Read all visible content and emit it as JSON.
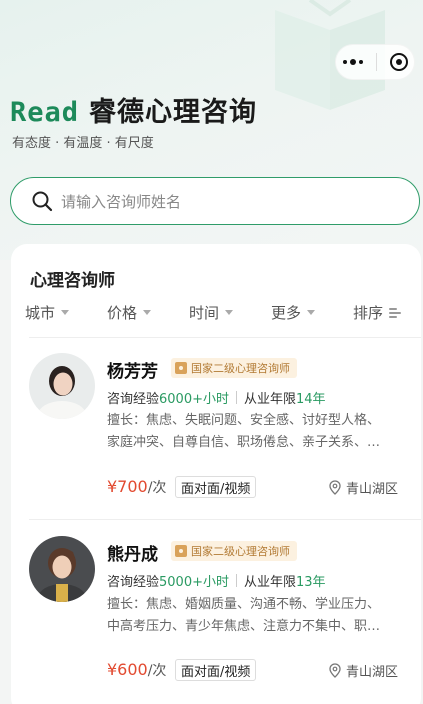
{
  "app": {
    "brand_en": "Read",
    "brand_cn": "睿德心理咨询",
    "slogan": "有态度 · 有温度 · 有尺度"
  },
  "search": {
    "placeholder": "请输入咨询师姓名"
  },
  "section": {
    "title": "心理咨询师"
  },
  "filters": [
    {
      "label": "城市"
    },
    {
      "label": "价格"
    },
    {
      "label": "时间"
    },
    {
      "label": "更多"
    },
    {
      "label": "排序"
    }
  ],
  "counselors": [
    {
      "name": "杨芳芳",
      "badge": "国家二级心理咨询师",
      "exp_label": "咨询经验",
      "exp_value": "6000+小时",
      "years_label": "从业年限",
      "years_value": "14年",
      "spec_line1": "擅长：焦虑、失眠问题、安全感、讨好型人格、",
      "spec_line2": "家庭冲突、自尊自信、职场倦怠、亲子关系、…",
      "price": "¥700",
      "price_unit": "/次",
      "mode": "面对面/视频",
      "location": "青山湖区"
    },
    {
      "name": "熊丹成",
      "badge": "国家二级心理咨询师",
      "exp_label": "咨询经验",
      "exp_value": "5000+小时",
      "years_label": "从业年限",
      "years_value": "13年",
      "spec_line1": "擅长：焦虑、婚姻质量、沟通不畅、学业压力、",
      "spec_line2": "中高考压力、青少年焦虑、注意力不集中、职…",
      "price": "¥600",
      "price_unit": "/次",
      "mode": "面对面/视频",
      "location": "青山湖区"
    }
  ],
  "colors": {
    "accent": "#2a9a62",
    "price": "#e24a30",
    "badge_bg": "#fcf1e0",
    "badge_text": "#b27a33"
  },
  "icons": [
    "more-dots-icon",
    "capsule-close-icon",
    "search-icon",
    "caret-down-icon",
    "sort-icon",
    "certificate-icon",
    "location-pin-icon"
  ]
}
